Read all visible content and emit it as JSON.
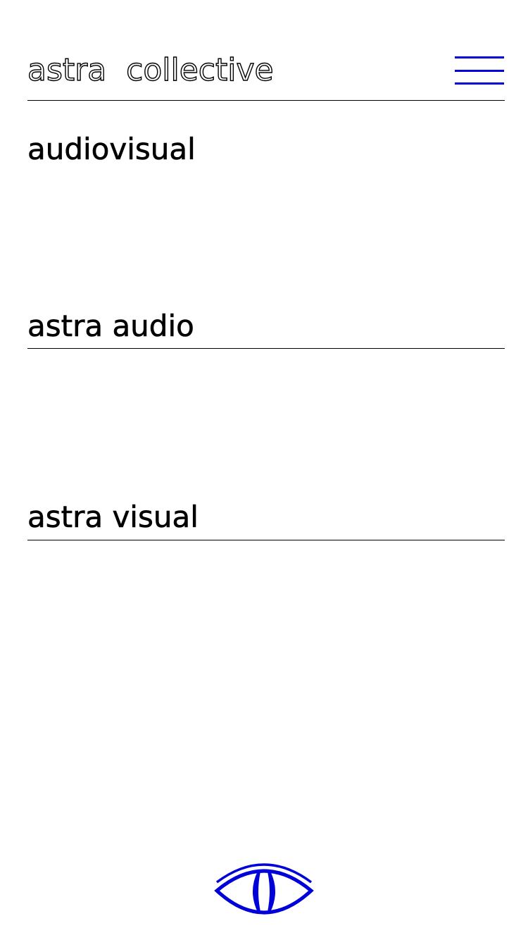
{
  "header": {
    "brand": "astra  collective",
    "menu_icon": "hamburger-menu-icon"
  },
  "sections": [
    {
      "title": "audiovisual"
    },
    {
      "title": "astra audio"
    },
    {
      "title": "astra visual"
    }
  ],
  "footer": {
    "logo_icon": "eye-icon"
  },
  "colors": {
    "accent": "#0000d8",
    "text": "#000000",
    "background": "#ffffff"
  }
}
